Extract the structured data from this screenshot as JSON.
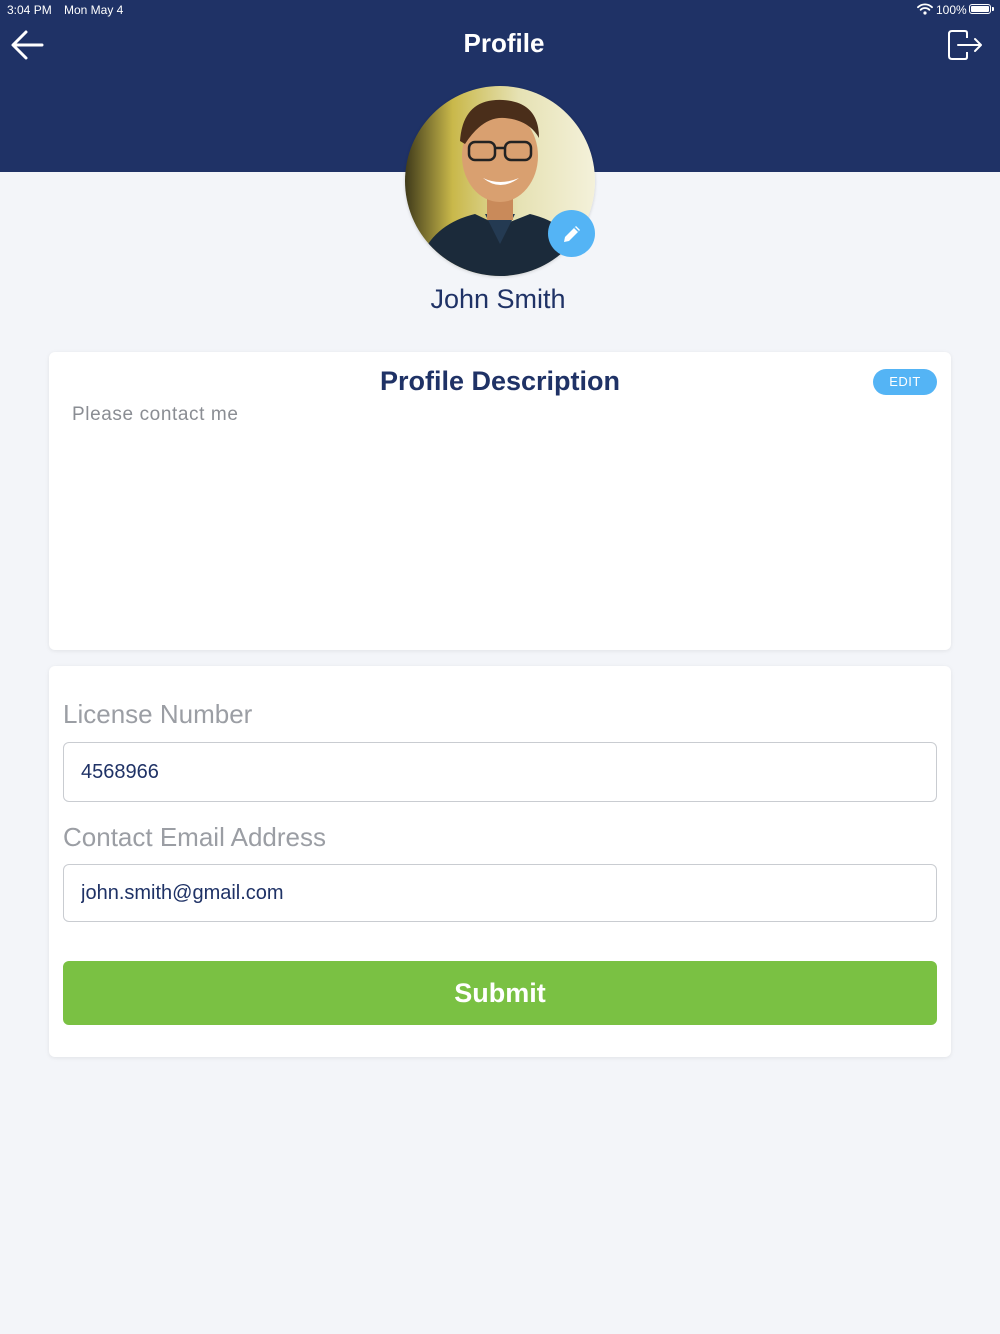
{
  "status_bar": {
    "time": "3:04 PM",
    "date": "Mon May 4",
    "battery": "100%"
  },
  "header": {
    "title": "Profile",
    "back_icon": "arrow-left-icon",
    "logout_icon": "logout-icon"
  },
  "profile": {
    "name": "John Smith",
    "avatar_icon": "user-photo",
    "edit_icon": "pencil-icon"
  },
  "description": {
    "title": "Profile Description",
    "edit_label": "EDIT",
    "text": "Please contact me"
  },
  "form": {
    "license_label": "License Number",
    "license_value": "4568966",
    "email_label": "Contact Email Address",
    "email_value": "john.smith@gmail.com",
    "submit_label": "Submit"
  },
  "colors": {
    "header_bg": "#1f3266",
    "accent_blue": "#54b4f5",
    "submit_green": "#7ac143",
    "page_bg": "#f3f5f9"
  }
}
